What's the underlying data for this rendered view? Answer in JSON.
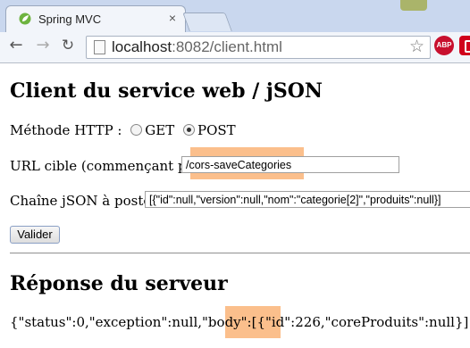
{
  "browser": {
    "tab_title": "Spring MVC",
    "tab_close": "×",
    "url_host": "localhost",
    "url_rest": ":8082/client.html",
    "back_glyph": "←",
    "forward_glyph": "→",
    "reload_glyph": "↻",
    "star_glyph": "☆",
    "ext_abp": "ABP"
  },
  "page": {
    "title": "Client du service web / jSON",
    "method_label": "Méthode HTTP :",
    "method_options": [
      "GET",
      "POST"
    ],
    "method_selected": "POST",
    "url_label": "URL cible (commençant par /):",
    "url_value": "/cors-saveCategories",
    "json_label": "Chaîne jSON à poster :",
    "json_value": "[{\"id\":null,\"version\":null,\"nom\":\"categorie[2]\",\"produits\":null}]",
    "submit_label": "Valider",
    "response_heading": "Réponse du serveur",
    "response_text": "{\"status\":0,\"exception\":null,\"body\":[{\"id\":226,\"coreProduits\":null}]}"
  },
  "colors": {
    "highlight": "#fbbf8c",
    "favicon": "#6db33f"
  }
}
